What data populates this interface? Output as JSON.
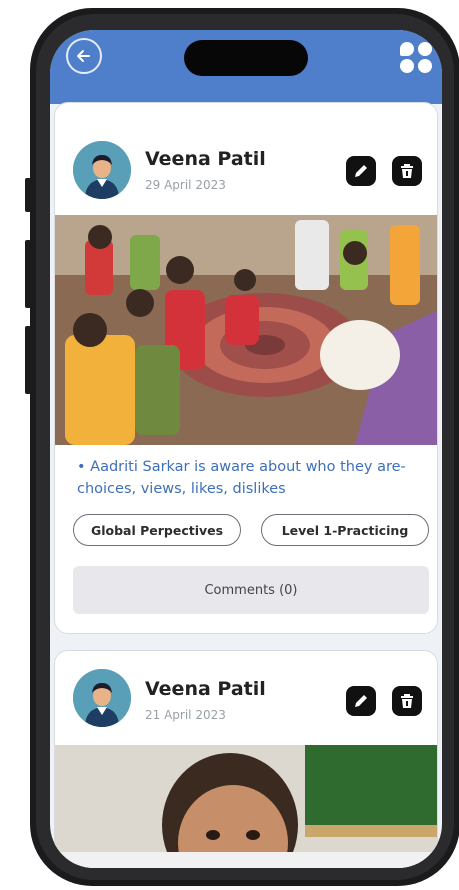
{
  "posts": [
    {
      "author": "Veena Patil",
      "date": "29 April 2023",
      "description": "• Aadriti  Sarkar is aware about who they are- choices, views, likes, dislikes",
      "tags": [
        "Global Perpectives",
        "Level 1-Practicing"
      ],
      "comments_label": "Comments (0)"
    },
    {
      "author": "Veena Patil",
      "date": "21 April 2023"
    }
  ],
  "icons": {
    "back": "back-arrow-icon",
    "menu": "grid-menu-icon",
    "edit": "pencil-icon",
    "delete": "trash-icon"
  },
  "colors": {
    "header": "#4f7fca",
    "description_text": "#3e6fb9",
    "avatar_bg": "#5a9fb8"
  }
}
